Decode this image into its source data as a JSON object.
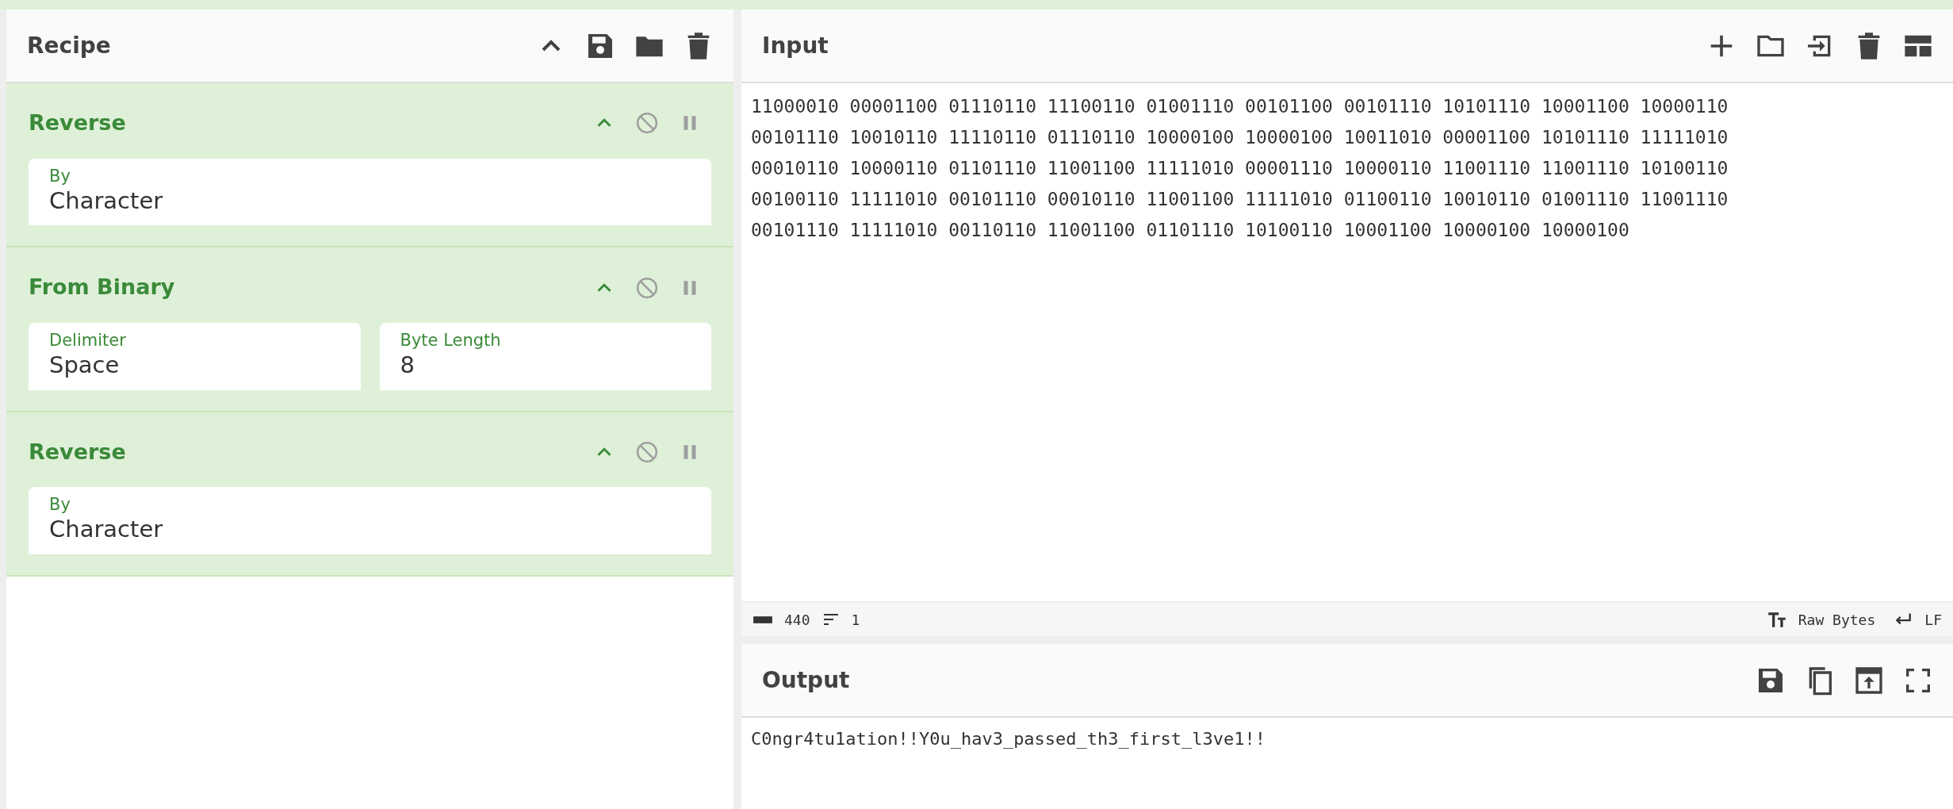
{
  "recipe": {
    "title": "Recipe",
    "operations": [
      {
        "name": "Reverse",
        "fields": [
          {
            "label": "By",
            "value": "Character"
          }
        ]
      },
      {
        "name": "From Binary",
        "fields": [
          {
            "label": "Delimiter",
            "value": "Space"
          },
          {
            "label": "Byte Length",
            "value": "8"
          }
        ]
      },
      {
        "name": "Reverse",
        "fields": [
          {
            "label": "By",
            "value": "Character"
          }
        ]
      }
    ]
  },
  "input": {
    "title": "Input",
    "text": "11000010 00001100 01110110 11100110 01001110 00101100 00101110 10101110 10001100 10000110 00101110 10010110 11110110 01110110 10000100 10000100 10011010 00001100 10101110 11111010 00010110 10000110 01101110 11001100 11111010 00001110 10000110 11001110 11001110 10100110 00100110 11111010 00101110 00010110 11001100 11111010 01100110 10010110 01001110 11001110 00101110 11111010 00110110 11001100 01101110 10100110 10001100 10000100 10000100",
    "length": "440",
    "lines": "1",
    "encoding": "Raw Bytes",
    "eol": "LF"
  },
  "output": {
    "title": "Output",
    "text": "C0ngr4tu1ation!!Y0u_hav3_passed_th3_first_l3ve1!!"
  }
}
